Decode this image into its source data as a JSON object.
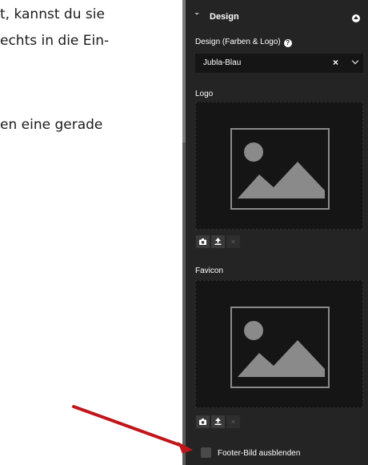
{
  "document": {
    "lines": [
      "t, kannst du sie",
      "echts in die Ein-",
      "en eine gerade"
    ]
  },
  "panel": {
    "icon": "paint-brush-icon",
    "title": "Design",
    "design_label": "Design (Farben & Logo)",
    "design_value": "Jubla-Blau",
    "logo_label": "Logo",
    "favicon_label": "Favicon",
    "footer_checkbox_label": "Footer-Bild ausblenden",
    "footer_checkbox_checked": false,
    "buttons": {
      "camera": "camera-icon",
      "upload": "upload-icon",
      "remove": "close-icon"
    }
  },
  "colors": {
    "panel_bg": "#242424",
    "arrow": "#c0151b"
  }
}
